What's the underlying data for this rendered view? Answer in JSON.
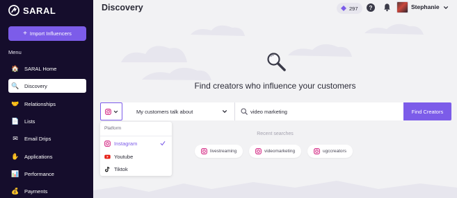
{
  "app": {
    "name": "SARAL"
  },
  "sidebar": {
    "import_button": "Import Influencers",
    "menu_heading": "Menu",
    "items": [
      {
        "label": "SARAL Home",
        "icon": "home-icon",
        "glyph": "🏠",
        "active": false
      },
      {
        "label": "Discovery",
        "icon": "magnifier-icon",
        "glyph": "🔍",
        "active": true
      },
      {
        "label": "Relationships",
        "icon": "handshake-icon",
        "glyph": "🤝",
        "active": false
      },
      {
        "label": "Lists",
        "icon": "list-icon",
        "glyph": "📄",
        "active": false
      },
      {
        "label": "Email Drips",
        "icon": "email-icon",
        "glyph": "✉",
        "active": false
      },
      {
        "label": "Applications",
        "icon": "hand-icon",
        "glyph": "✋",
        "active": false
      },
      {
        "label": "Performance",
        "icon": "chart-icon",
        "glyph": "📊",
        "active": false
      },
      {
        "label": "Payments",
        "icon": "money-bag-icon",
        "glyph": "💰",
        "active": false
      }
    ]
  },
  "header": {
    "title": "Discovery",
    "credits": "297",
    "help": "?",
    "user_name": "Stephanie"
  },
  "main": {
    "headline": "Find creators who influence your customers",
    "topic_select": "My customers talk about",
    "search_value": "video marketing",
    "find_button": "Find Creators",
    "recent_title": "Recent searches",
    "recent": [
      "livestreaming",
      "videomarketing",
      "ugccreators"
    ]
  },
  "platform_dropdown": {
    "heading": "Platform",
    "options": [
      {
        "label": "Instagram",
        "icon": "instagram-icon",
        "selected": true
      },
      {
        "label": "Youtube",
        "icon": "youtube-icon",
        "selected": false
      },
      {
        "label": "Tiktok",
        "icon": "tiktok-icon",
        "selected": false
      }
    ]
  },
  "colors": {
    "accent": "#7c5ce9",
    "sidebar": "#150d2c",
    "background": "#f2f2f4"
  }
}
